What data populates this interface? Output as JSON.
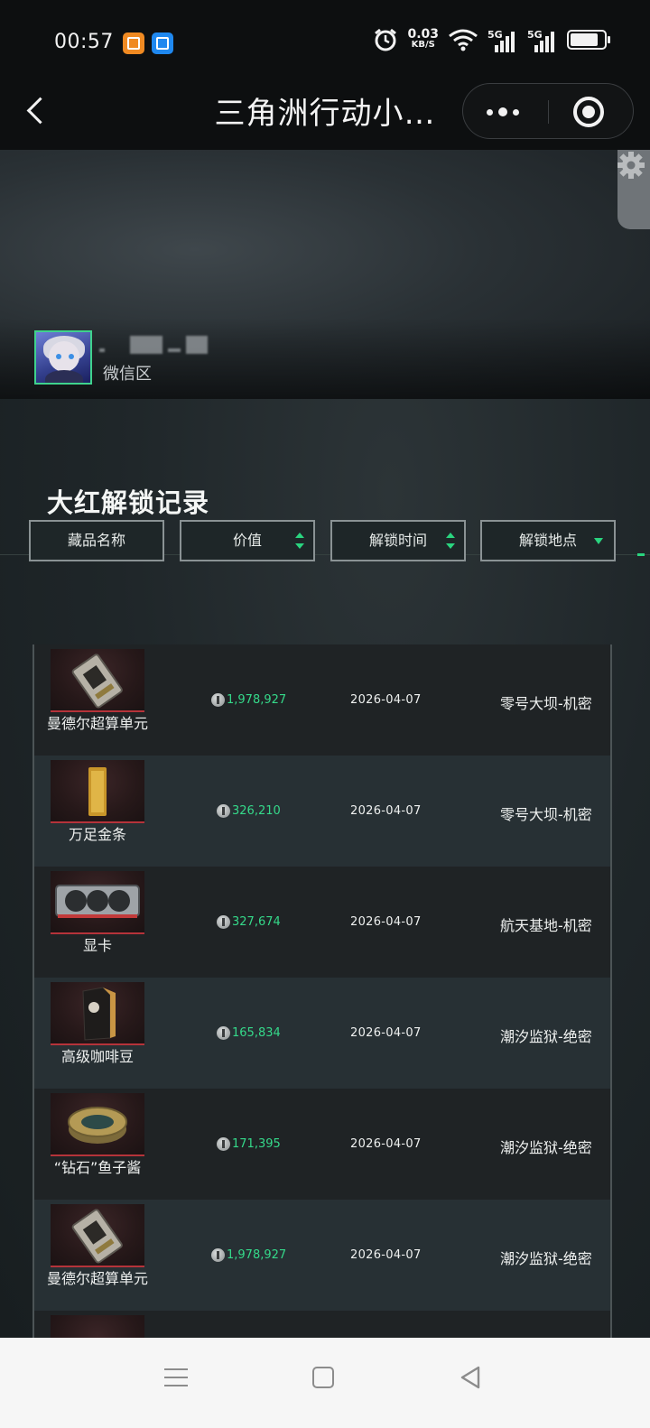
{
  "status_bar": {
    "time": "00:57",
    "net_speed": "0.03",
    "net_unit": "KB/S",
    "signal_1": "5G",
    "signal_2": "5G"
  },
  "title_bar": {
    "title": "三角洲行动小…"
  },
  "profile": {
    "zone": "微信区"
  },
  "records": {
    "title": "大红解锁记录",
    "filters": {
      "name": "藏品名称",
      "value": "价值",
      "time": "解锁时间",
      "location": "解锁地点"
    },
    "rows": [
      {
        "name": "曼德尔超算单元",
        "value": "1,978,927",
        "date": "2026-04-07",
        "location": "零号大坝-机密"
      },
      {
        "name": "万足金条",
        "value": "326,210",
        "date": "2026-04-07",
        "location": "零号大坝-机密"
      },
      {
        "name": "显卡",
        "value": "327,674",
        "date": "2026-04-07",
        "location": "航天基地-机密"
      },
      {
        "name": "高级咖啡豆",
        "value": "165,834",
        "date": "2026-04-07",
        "location": "潮汐监狱-绝密"
      },
      {
        "name": "“钻石”鱼子酱",
        "value": "171,395",
        "date": "2026-04-07",
        "location": "潮汐监狱-绝密"
      },
      {
        "name": "曼德尔超算单元",
        "value": "1,978,927",
        "date": "2026-04-07",
        "location": "潮汐监狱-绝密"
      }
    ]
  },
  "icons": [
    "back-icon",
    "more-icon",
    "target-icon",
    "gear-icon",
    "coin-icon",
    "sort-icon",
    "caret-down-icon",
    "menu-icon",
    "home-icon",
    "nav-back-icon"
  ],
  "colors": {
    "accent_green": "#35d98a",
    "rarity_red": "#b5333a",
    "avatar_border": "#3fd28d"
  }
}
